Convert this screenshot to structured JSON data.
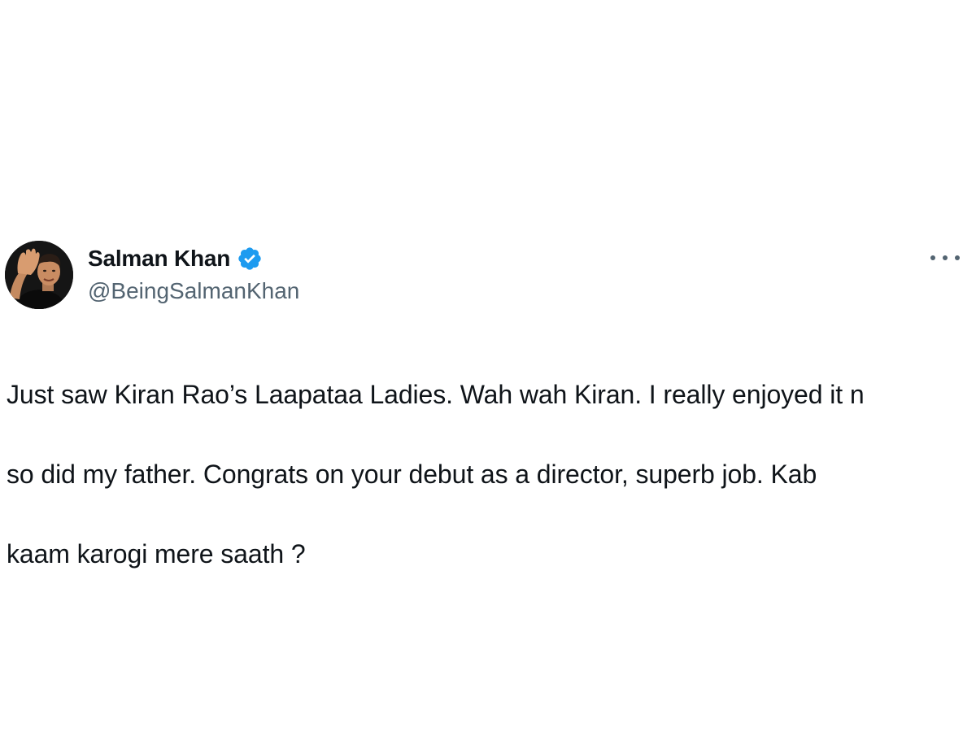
{
  "tweet": {
    "author": {
      "display_name": "Salman Khan",
      "handle": "@BeingSalmanKhan",
      "verified": true,
      "avatar_icon": "profile-photo-waving"
    },
    "more_icon": "more-horizontal-icon",
    "text_lines": [
      "Just saw Kiran Rao’s Laapataa Ladies. Wah wah Kiran. I really enjoyed it n",
      "so did my father. Congrats on your debut as a director, superb job. Kab",
      "kaam karogi mere saath ?"
    ]
  },
  "colors": {
    "background": "#ffffff",
    "primary_text": "#0f1419",
    "secondary_text": "#536471",
    "verified_badge": "#1d9bf0"
  }
}
